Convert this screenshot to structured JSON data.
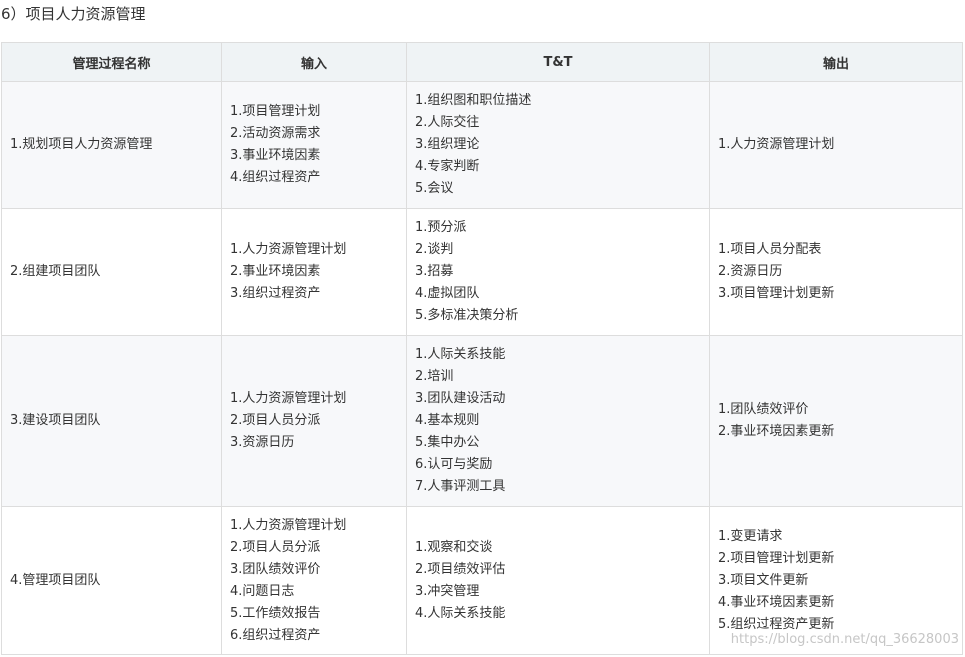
{
  "section_title": "6）项目人力资源管理",
  "table": {
    "headers": [
      "管理过程名称",
      "输入",
      "T&T",
      "输出"
    ],
    "rows": [
      {
        "name": "1.规划项目人力资源管理",
        "inputs": [
          "1.项目管理计划",
          "2.活动资源需求",
          "3.事业环境因素",
          "4.组织过程资产"
        ],
        "tools": [
          "1.组织图和职位描述",
          "2.人际交往",
          "3.组织理论",
          "4.专家判断",
          "5.会议"
        ],
        "outputs": [
          "1.人力资源管理计划"
        ]
      },
      {
        "name": "2.组建项目团队",
        "inputs": [
          "1.人力资源管理计划",
          "2.事业环境因素",
          "3.组织过程资产"
        ],
        "tools": [
          "1.预分派",
          "2.谈判",
          "3.招募",
          "4.虚拟团队",
          "5.多标准决策分析"
        ],
        "outputs": [
          "1.项目人员分配表",
          "2.资源日历",
          "3.项目管理计划更新"
        ]
      },
      {
        "name": "3.建设项目团队",
        "inputs": [
          "1.人力资源管理计划",
          "2.项目人员分派",
          "3.资源日历"
        ],
        "tools": [
          "1.人际关系技能",
          "2.培训",
          "3.团队建设活动",
          "4.基本规则",
          "5.集中办公",
          "6.认可与奖励",
          "7.人事评测工具"
        ],
        "outputs": [
          "1.团队绩效评价",
          "2.事业环境因素更新"
        ]
      },
      {
        "name": "4.管理项目团队",
        "inputs": [
          "1.人力资源管理计划",
          "2.项目人员分派",
          "3.团队绩效评价",
          "4.问题日志",
          "5.工作绩效报告",
          "6.组织过程资产"
        ],
        "tools": [
          "1.观察和交谈",
          "2.项目绩效评估",
          "3.冲突管理",
          "4.人际关系技能"
        ],
        "outputs": [
          "1.变更请求",
          "2.项目管理计划更新",
          "3.项目文件更新",
          "4.事业环境因素更新",
          "5.组织过程资产更新"
        ]
      }
    ]
  },
  "watermark": "https://blog.csdn.net/qq_36628003"
}
